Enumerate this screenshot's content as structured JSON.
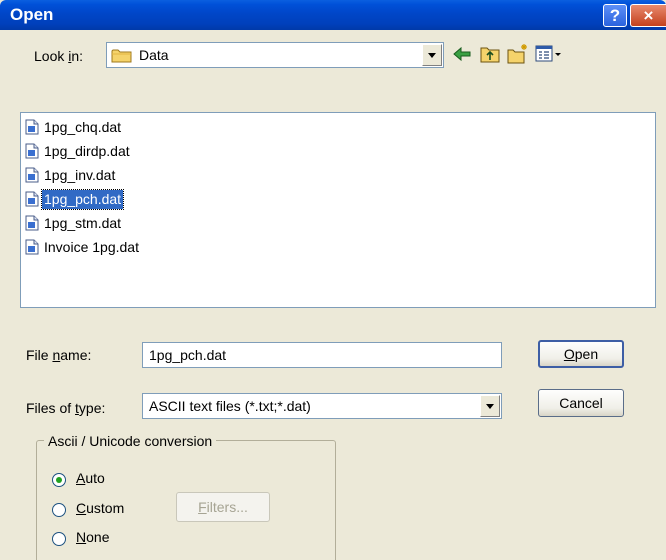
{
  "window": {
    "title": "Open",
    "help_label": "?",
    "close_label": "×"
  },
  "lookin": {
    "label_pre": "Look ",
    "label_u": "i",
    "label_post": "n:",
    "value": "Data"
  },
  "files": [
    {
      "name": "1pg_chq.dat",
      "selected": false
    },
    {
      "name": "1pg_dirdp.dat",
      "selected": false
    },
    {
      "name": "1pg_inv.dat",
      "selected": false
    },
    {
      "name": "1pg_pch.dat",
      "selected": true
    },
    {
      "name": "1pg_stm.dat",
      "selected": false
    },
    {
      "name": "Invoice 1pg.dat",
      "selected": false
    }
  ],
  "filename": {
    "label_pre": "File ",
    "label_u": "n",
    "label_post": "ame:",
    "value": "1pg_pch.dat"
  },
  "filetype": {
    "label_pre": "Files of ",
    "label_u": "t",
    "label_post": "ype:",
    "value": "ASCII text files (*.txt;*.dat)"
  },
  "buttons": {
    "open_u": "O",
    "open_rest": "pen",
    "cancel": "Cancel"
  },
  "conversion": {
    "title": "Ascii / Unicode conversion",
    "options": [
      {
        "u": "A",
        "rest": "uto",
        "checked": true
      },
      {
        "u": "C",
        "rest": "ustom",
        "checked": false
      },
      {
        "u": "N",
        "rest": "one",
        "checked": false
      }
    ],
    "filters_u": "F",
    "filters_rest": "ilters..."
  },
  "colors": {
    "titlebar": "#0046c8",
    "selection": "#316ac5",
    "dialog_bg": "#ece9d8"
  }
}
